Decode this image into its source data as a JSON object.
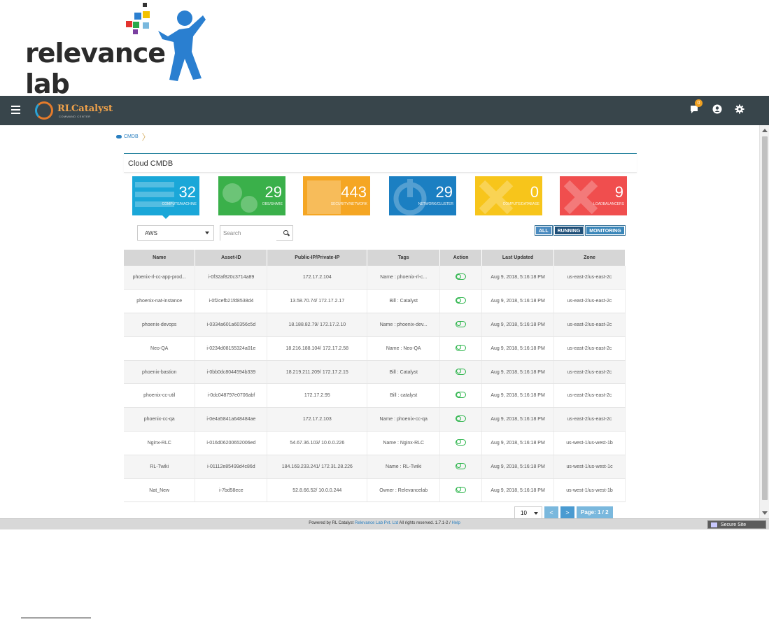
{
  "brand": {
    "company_name": "relevance lab"
  },
  "navbar": {
    "app_name": "RLCatalyst",
    "app_tagline": "COMMAND CENTER",
    "notification_count": "0"
  },
  "breadcrumb": {
    "label": "CMDB"
  },
  "panel": {
    "title": "Cloud CMDB"
  },
  "tiles": [
    {
      "count": "32",
      "label": "COMPUTE/MACHINE",
      "color": "#1aa7d8"
    },
    {
      "count": "29",
      "label": "DBS/SHARE",
      "color": "#3ab04a"
    },
    {
      "count": "443",
      "label": "SECURITY/NETWORK",
      "color": "#f5a623"
    },
    {
      "count": "29",
      "label": "NETWORK/CLUSTER",
      "color": "#1b7fc2"
    },
    {
      "count": "0",
      "label": "COMPUTE/DATABASE",
      "color": "#f7c51b"
    },
    {
      "count": "9",
      "label": "LOADBALANCERS",
      "color": "#f04e4e"
    }
  ],
  "filters": {
    "provider_selected": "AWS",
    "search_placeholder": "Search",
    "buttons": [
      "ALL",
      "RUNNING",
      "MONITORING"
    ]
  },
  "table": {
    "headers": [
      "Name",
      "Asset-ID",
      "Public-IP/Private-IP",
      "Tags",
      "Action",
      "Last Updated",
      "Zone"
    ],
    "rows": [
      [
        "phoenix-rl-cc-app-prod...",
        "i-0f32af820c3714a89",
        "172.17.2.104",
        "Name : phoenix-rl-c...",
        "",
        "Aug 9, 2018, 5:16:18 PM",
        "us-east-2/us-east-2c"
      ],
      [
        "phoenix-nat-instance",
        "i-0f2cefb21fd8538d4",
        "13.58.70.74/ 172.17.2.17",
        "Bill : Catalyst",
        "",
        "Aug 9, 2018, 5:16:18 PM",
        "us-east-2/us-east-2c"
      ],
      [
        "phoenix-devops",
        "i-0334a601a60356c5d",
        "18.188.82.79/ 172.17.2.10",
        "Name : phoenix-dev...",
        "",
        "Aug 9, 2018, 5:16:18 PM",
        "us-east-2/us-east-2c"
      ],
      [
        "Neo-QA",
        "i-0234d08155324a01e",
        "18.216.188.104/ 172.17.2.58",
        "Name : Neo-QA",
        "",
        "Aug 9, 2018, 5:16:18 PM",
        "us-east-2/us-east-2c"
      ],
      [
        "phoenix-bastion",
        "i-0bb0dc8044594b339",
        "18.219.211.209/ 172.17.2.15",
        "Bill : Catalyst",
        "",
        "Aug 9, 2018, 5:16:18 PM",
        "us-east-2/us-east-2c"
      ],
      [
        "phoenix-cc-util",
        "i-0dc048797e0706abf",
        "172.17.2.95",
        "Bill : catalyst",
        "",
        "Aug 9, 2018, 5:16:18 PM",
        "us-east-2/us-east-2c"
      ],
      [
        "phoenix-cc-qa",
        "i-0e4a5841a648484ae",
        "172.17.2.103",
        "Name : phoenix-cc-qa",
        "",
        "Aug 9, 2018, 5:16:18 PM",
        "us-east-2/us-east-2c"
      ],
      [
        "Nginx-RLC",
        "i-016d06200652006ed",
        "54.67.36.103/ 10.0.0.226",
        "Name : Nginx-RLC",
        "",
        "Aug 9, 2018, 5:16:18 PM",
        "us-west-1/us-west-1b"
      ],
      [
        "RL-Twiki",
        "i-01112e85499d4c86d",
        "184.169.233.241/ 172.31.28.226",
        "Name : RL-Twiki",
        "",
        "Aug 9, 2018, 5:16:18 PM",
        "us-west-1/us-west-1c"
      ],
      [
        "Nat_New",
        "i-7bd58ece",
        "52.8.66.52/ 10.0.0.244",
        "Owner : Relevancelab",
        "",
        "Aug 9, 2018, 5:16:18 PM",
        "us-west-1/us-west-1b"
      ]
    ]
  },
  "pager": {
    "page_size": "10",
    "prev_label": "<",
    "next_label": ">",
    "page_label": "Page: 1 / 2"
  },
  "footer": {
    "prefix": "Powered by RL Catalyst",
    "company": "Relevance Lab Pvt. Ltd",
    "rights": "All rights reserved. 1.7.1-2 /",
    "help": "Help",
    "secure_site": "Secure Site"
  }
}
